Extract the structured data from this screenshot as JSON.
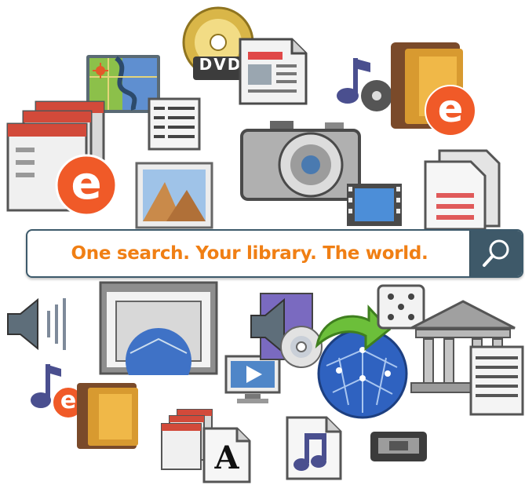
{
  "search": {
    "tagline": "One search. Your library. The world.",
    "button_icon": "search-icon"
  },
  "icons": {
    "dvd_label": "DVD",
    "ebook_letter": "e",
    "font_letter": "A"
  },
  "colors": {
    "accent_orange": "#f07f14",
    "search_button": "#3e5969",
    "ebook_badge": "#f05a28",
    "music_note": "#4a4f8f"
  }
}
